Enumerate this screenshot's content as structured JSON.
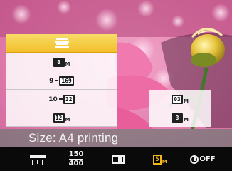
{
  "size_menu": {
    "items": [
      {
        "id": "a4-printing",
        "icon": "a4-print-size-icon",
        "selected": true
      },
      {
        "id": "size-8m",
        "icon": "8m-size-icon",
        "label": "8",
        "sub": "M"
      },
      {
        "id": "size-9m-169",
        "icon": "9m-169-size-icon",
        "label": "9",
        "box": "169"
      },
      {
        "id": "size-10m-32",
        "icon": "10m-32-size-icon",
        "label": "10",
        "box": "32"
      },
      {
        "id": "size-12m",
        "icon": "12m-size-icon",
        "label": "12",
        "sub": "M"
      }
    ],
    "right_items": [
      {
        "id": "size-03m",
        "icon": "03m-size-icon",
        "label": "03",
        "sub": "M"
      },
      {
        "id": "size-3m",
        "icon": "3m-size-icon",
        "label": "3",
        "sub": "M"
      }
    ]
  },
  "description": "Size: A4 printing",
  "icon_bar": {
    "items": [
      {
        "id": "color-tone",
        "icon": "color-tone-icon"
      },
      {
        "id": "iso",
        "icon": "iso-icon",
        "top": "150",
        "bottom": "400"
      },
      {
        "id": "aspect",
        "icon": "aspect-ratio-icon"
      },
      {
        "id": "image-size",
        "icon": "image-size-icon",
        "label": "5",
        "sub": "M",
        "active": true
      },
      {
        "id": "self-timer",
        "icon": "self-timer-icon",
        "label": "OFF"
      }
    ]
  },
  "colors": {
    "selected_item": "#f2c43a",
    "active_icon": "#f5b81c",
    "desc_bar": "#7a7a7a",
    "icon_bar": "#0a0a0a"
  }
}
